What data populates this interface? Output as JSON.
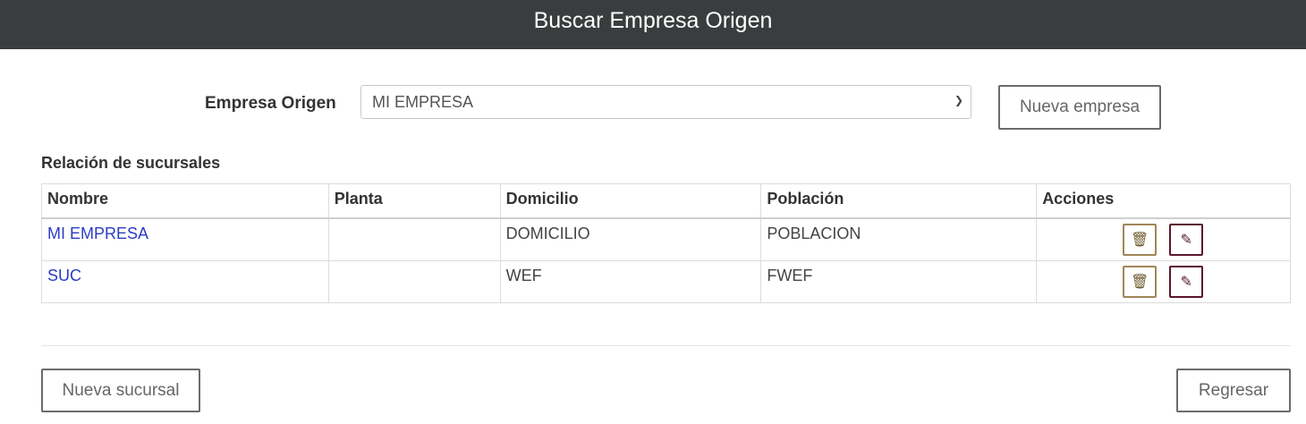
{
  "header": {
    "title": "Buscar Empresa Origen"
  },
  "form": {
    "empresa_label": "Empresa Origen",
    "empresa_selected": "MI EMPRESA",
    "nueva_empresa_label": "Nueva empresa"
  },
  "section": {
    "title": "Relación de sucursales"
  },
  "table": {
    "headers": [
      "Nombre",
      "Planta",
      "Domicilio",
      "Población",
      "Acciones"
    ],
    "rows": [
      {
        "nombre": "MI EMPRESA",
        "planta": "",
        "domicilio": "DOMICILIO",
        "poblacion": "POBLACION"
      },
      {
        "nombre": "SUC",
        "planta": "",
        "domicilio": "WEF",
        "poblacion": "FWEF"
      }
    ]
  },
  "footer": {
    "nueva_sucursal_label": "Nueva sucursal",
    "regresar_label": "Regresar"
  },
  "icons": {
    "delete": "trash-icon",
    "edit": "pencil-icon",
    "select_arrow": "chevron-down-icon"
  },
  "colors": {
    "header_bg": "#3a3d3e",
    "link": "#2b3cc4",
    "delete_border": "#a08658",
    "edit_border": "#5b1630"
  }
}
